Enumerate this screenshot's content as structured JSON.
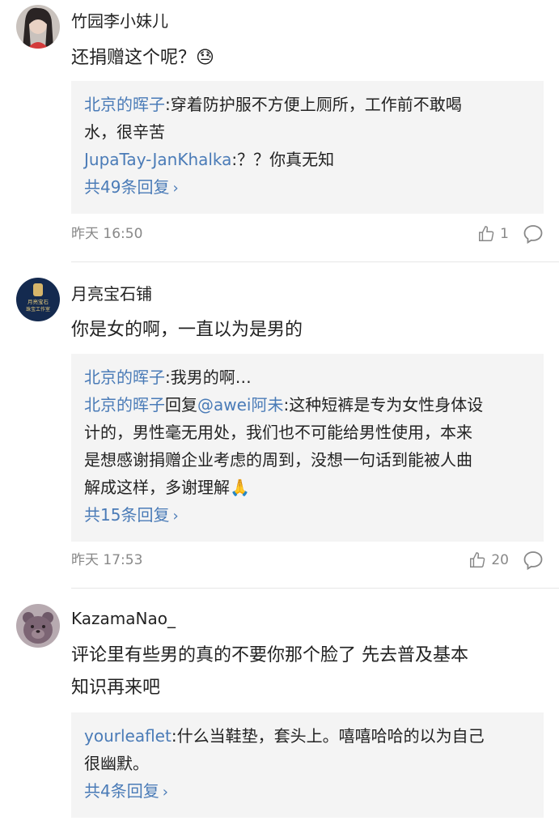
{
  "comments": [
    {
      "username": "竹园李小妹儿",
      "text": "还捐赠这个呢？😓",
      "replies": [
        {
          "name": "北京的晖子",
          "text": ":穿着防护服不方便上厕所，工作前不敢喝"
        },
        {
          "name": "",
          "text": "水，很辛苦"
        },
        {
          "name": "JupaTay-JanKhalka",
          "text": ":？？你真无知"
        }
      ],
      "more": "共49条回复",
      "time": "昨天 16:50",
      "likes": "1"
    },
    {
      "username": "月亮宝石铺",
      "avatar_text": "月亮宝石\n珠宝工作室",
      "text": "你是女的啊，一直以为是男的",
      "replies": [
        {
          "name": "北京的晖子",
          "text": ":我男的啊…"
        },
        {
          "name": "北京的晖子",
          "text": "回复"
        },
        {
          "name": "@awei阿未",
          "text": ":这种短裤是专为女性身体设"
        },
        {
          "name": "",
          "text": "计的，男性毫无用处，我们也不可能给男性使用，本来"
        },
        {
          "name": "",
          "text": "是想感谢捐赠企业考虑的周到，没想一句话到能被人曲"
        },
        {
          "name": "",
          "text": "解成这样，多谢理解🙏"
        }
      ],
      "more": "共15条回复",
      "time": "昨天 17:53",
      "likes": "20"
    },
    {
      "username": "KazamaNao_",
      "text_lines": [
        "评论里有些男的真的不要你那个脸了 先去普及基本",
        "知识再来吧"
      ],
      "replies": [
        {
          "name": "yourleaflet",
          "text": ":什么当鞋垫，套头上。嘻嘻哈哈的以为自己"
        },
        {
          "name": "",
          "text": "很幽默。"
        }
      ],
      "more": "共4条回复"
    }
  ],
  "icons": {
    "like": "thumbs-up-icon",
    "reply": "comment-bubble-icon",
    "more": "chevron-right-icon"
  },
  "colors": {
    "link": "#4a7bb7",
    "reply_bg": "#f4f4f4",
    "meta": "#888888"
  }
}
